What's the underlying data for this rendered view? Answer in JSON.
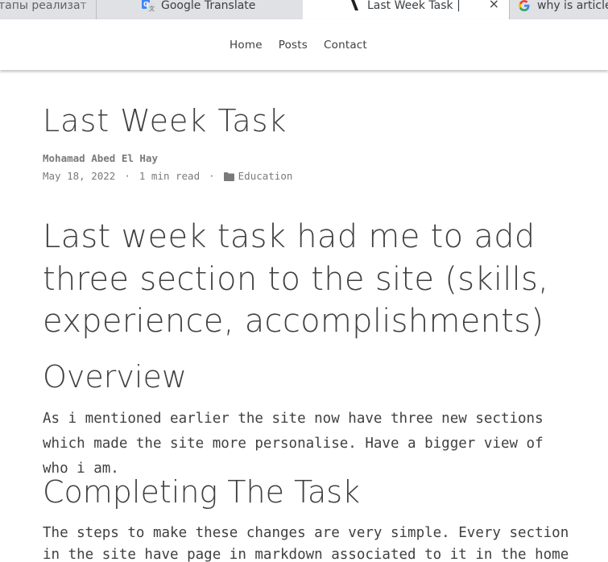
{
  "browser": {
    "tabs": [
      {
        "label": "тапы реализат",
        "icon": "partial-tab",
        "active": false
      },
      {
        "label": "Google Translate",
        "icon": "google-translate-icon",
        "active": false
      },
      {
        "label": "Last Week Task |",
        "icon": "site-favicon-icon",
        "active": true,
        "close": "×"
      },
      {
        "label": "why is article",
        "icon": "google-icon",
        "active": false
      }
    ]
  },
  "nav": {
    "items": [
      "Home",
      "Posts",
      "Contact"
    ]
  },
  "article": {
    "title": "Last Week Task",
    "author": "Mohamad Abed El Hay",
    "date": "May 18, 2022",
    "separator": "·",
    "read_time": "1 min read",
    "category": "Education",
    "lead": "Last week task had me to add three section to the site (skills, experience, accomplishments)",
    "sections": [
      {
        "heading": "Overview",
        "body": "As i mentioned earlier the site now have three new sections which made the site more personalise. Have a bigger view of who i am."
      },
      {
        "heading": "Completing The Task",
        "body": "The steps to make these changes are very simple. Every section in the site have page in markdown associated to it in the home directory. For"
      }
    ]
  },
  "colors": {
    "text": "#404040",
    "meta": "#7a7a7a",
    "tabstrip": "#dfe1e5"
  }
}
